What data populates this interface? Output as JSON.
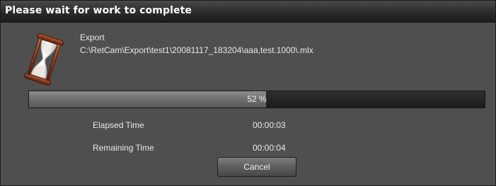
{
  "window": {
    "title": "Please wait for work to complete"
  },
  "task": {
    "icon": "hourglass-icon",
    "operation": "Export",
    "path": "C:\\RetCam\\Export\\test1\\20081117_183204\\aaa,test.1000\\.mlx"
  },
  "progress": {
    "percent": 52,
    "label": "52 %"
  },
  "timing": {
    "elapsed_label": "Elapsed Time",
    "elapsed_value": "00:00:03",
    "remaining_label": "Remaining Time",
    "remaining_value": "00:00:04"
  },
  "buttons": {
    "cancel_label": "Cancel"
  },
  "colors": {
    "background": "#4f4f4f",
    "titlebar": "#2a2a2a",
    "progress_fill": "#707070",
    "progress_track": "#1c1c1c",
    "hourglass_wood": "#8b3a1a"
  }
}
